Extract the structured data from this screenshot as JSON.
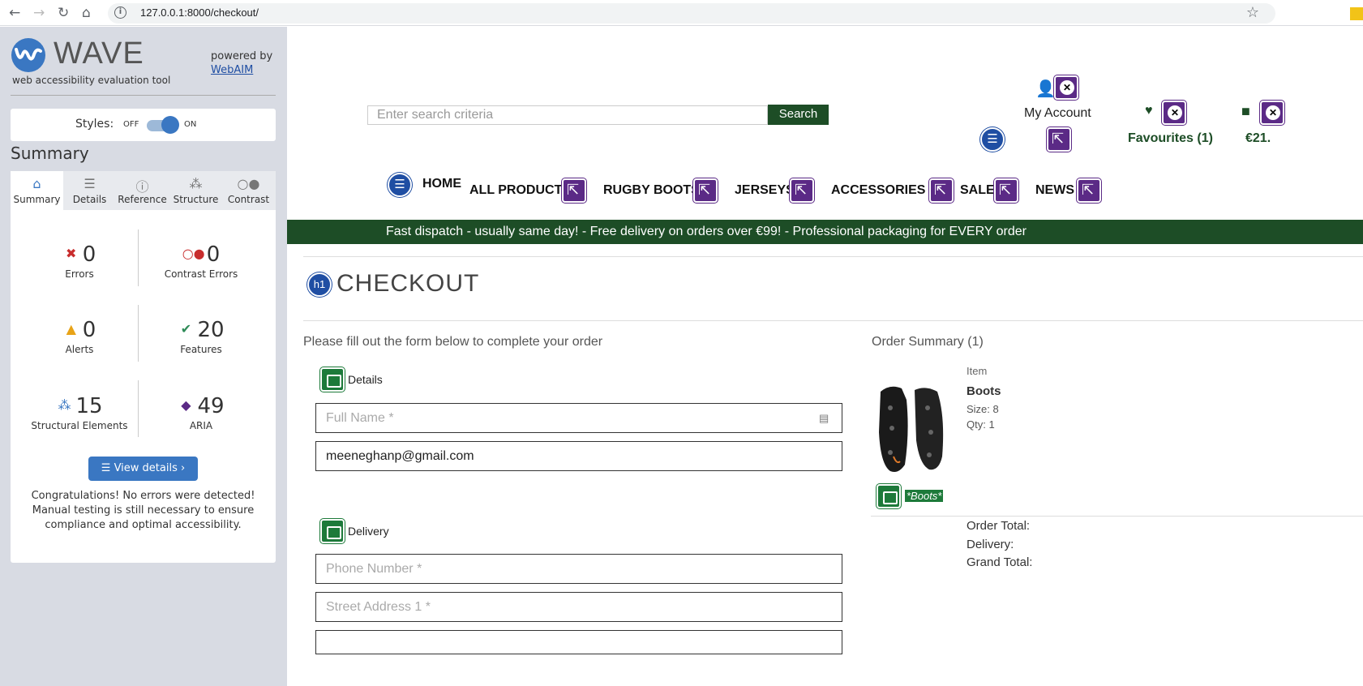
{
  "browser": {
    "url": "127.0.0.1:8000/checkout/",
    "icons": [
      "back-icon",
      "forward-icon",
      "reload-icon",
      "home-icon",
      "info-icon",
      "bookmark-star-icon"
    ]
  },
  "wave": {
    "brand": "WAVE",
    "subtitle": "web accessibility evaluation tool",
    "powered_by": "powered by",
    "webaim": "WebAIM",
    "styles_label": "Styles:",
    "off": "OFF",
    "on": "ON",
    "summary_title": "Summary",
    "tabs": [
      "Summary",
      "Details",
      "Reference",
      "Structure",
      "Contrast"
    ],
    "stats": {
      "errors": {
        "value": "0",
        "label": "Errors"
      },
      "contrast": {
        "value": "0",
        "label": "Contrast Errors"
      },
      "alerts": {
        "value": "0",
        "label": "Alerts"
      },
      "features": {
        "value": "20",
        "label": "Features"
      },
      "structural": {
        "value": "15",
        "label": "Structural Elements"
      },
      "aria": {
        "value": "49",
        "label": "ARIA"
      }
    },
    "view_details": "View details ›",
    "congrats": "Congratulations! No errors were detected! Manual testing is still necessary to ensure compliance and optimal accessibility.",
    "colors": {
      "accent": "#3a77c2",
      "panel_bg": "#d8dbe3"
    }
  },
  "site": {
    "search_placeholder": "Enter search criteria",
    "search_button": "Search",
    "my_account": "My Account",
    "favourites": "Favourites (1)",
    "cart_total": "€21.",
    "menu": [
      "HOME",
      "ALL PRODUCTS",
      "RUGBY BOOTS",
      "JERSEYS",
      "ACCESSORIES",
      "SALE",
      "NEWS"
    ],
    "banner": "Fast dispatch - usually same day! - Free delivery on orders over €99! - Professional packaging for EVERY order",
    "h1_badge": "h1",
    "heading": "CHECKOUT",
    "intro": "Please fill out the form below to complete your order",
    "details_title": "Details",
    "delivery_title": "Delivery",
    "fields": {
      "full_name": "Full Name *",
      "email": "meeneghanp@gmail.com",
      "phone": "Phone Number *",
      "street1": "Street Address 1 *"
    },
    "order_summary": "Order Summary (1)",
    "item_label": "Item",
    "item_name": "Boots",
    "item_size": "Size: 8",
    "item_qty": "Qty: 1",
    "item_alt": "*Boots*",
    "order_total": "Order Total:",
    "delivery": "Delivery:",
    "grand_total": "Grand Total:",
    "colors": {
      "brand_green": "#1d4d26",
      "wave_purple": "#5b2a86"
    }
  }
}
